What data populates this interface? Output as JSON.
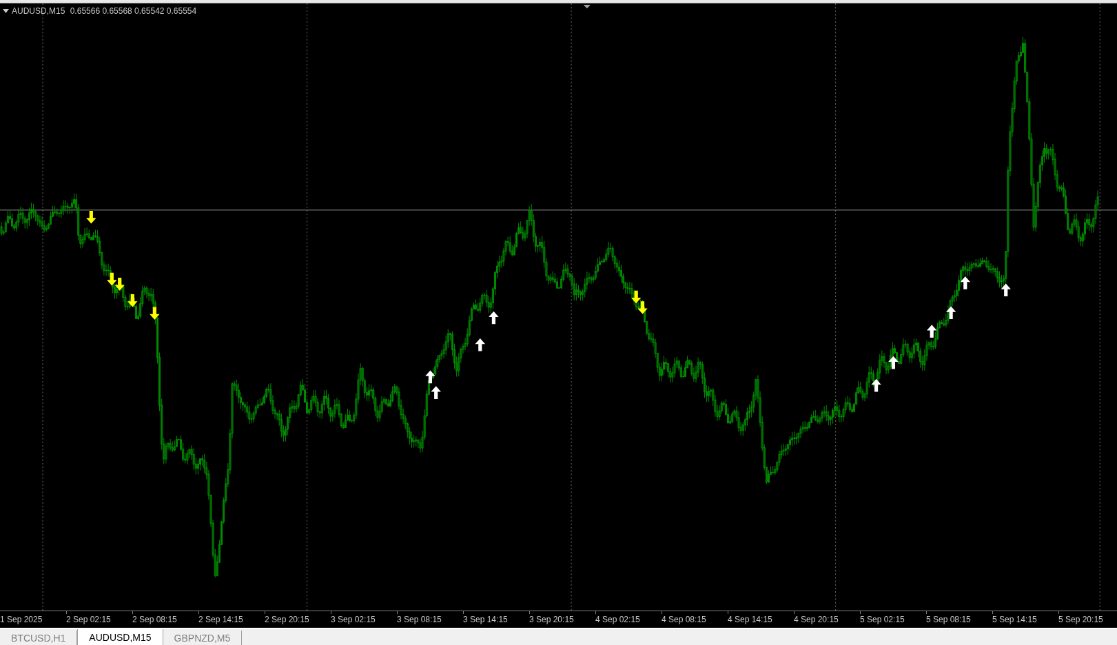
{
  "chart": {
    "symbol": "AUDUSD,M15",
    "prices": "0.65566 0.65568 0.65542 0.65554"
  },
  "time_axis": [
    "1 Sep 2025",
    "2 Sep 02:15",
    "2 Sep 08:15",
    "2 Sep 14:15",
    "2 Sep 20:15",
    "3 Sep 02:15",
    "3 Sep 08:15",
    "3 Sep 14:15",
    "3 Sep 20:15",
    "4 Sep 02:15",
    "4 Sep 08:15",
    "4 Sep 14:15",
    "4 Sep 20:15",
    "5 Sep 02:15",
    "5 Sep 08:15",
    "5 Sep 14:15",
    "5 Sep 20:15"
  ],
  "tabs": [
    {
      "label": "BTCUSD,H1",
      "selected": false
    },
    {
      "label": "AUDUSD,M15",
      "selected": true
    },
    {
      "label": "GBPNZD,M5",
      "selected": false
    }
  ]
}
